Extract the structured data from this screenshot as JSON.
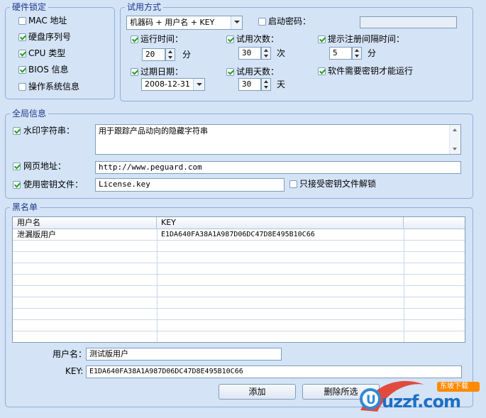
{
  "hardware": {
    "title": "硬件锁定",
    "items": [
      {
        "label": "MAC 地址",
        "checked": false
      },
      {
        "label": "硬盘序列号",
        "checked": true
      },
      {
        "label": "CPU 类型",
        "checked": true
      },
      {
        "label": "BIOS 信息",
        "checked": true
      },
      {
        "label": "操作系统信息",
        "checked": false
      }
    ]
  },
  "trial": {
    "title": "试用方式",
    "mode_select": "机器码 + 用户名 + KEY",
    "startup_password_label": "启动密码：",
    "startup_password_value": "",
    "run_time_label": "运行时间：",
    "run_time_value": "20",
    "run_time_unit": "分",
    "trial_count_label": "试用次数：",
    "trial_count_value": "30",
    "trial_count_unit": "次",
    "reg_interval_label": "提示注册间隔时间：",
    "reg_interval_value": "5",
    "reg_interval_unit": "分",
    "expiry_label": "过期日期：",
    "expiry_value": "2008-12-31",
    "trial_days_label": "试用天数：",
    "trial_days_value": "30",
    "trial_days_unit": "天",
    "need_key_label": "软件需要密钥才能运行"
  },
  "global": {
    "title": "全局信息",
    "watermark_label": "水印字符串：",
    "watermark_value": "用于跟踪产品动向的隐藏字符串",
    "url_label": "网页地址：",
    "url_value": "http://www.peguard.com",
    "keyfile_label": "使用密钥文件：",
    "keyfile_value": "License.key",
    "keyfile_only_label": "只接受密钥文件解锁"
  },
  "blacklist": {
    "title": "黑名单",
    "columns": [
      "用户名",
      "KEY"
    ],
    "rows": [
      {
        "user": "泄漏版用户",
        "key": "E1DA640FA38A1A987D06DC47D8E495B10C66"
      }
    ],
    "username_label": "用户名：",
    "username_value": "测试版用户",
    "key_label": "KEY:",
    "key_value": "E1DA640FA38A1A987D06DC47D8E495B10C66",
    "add_button": "添加",
    "delete_button": "删除所选"
  },
  "watermark_logo": {
    "text": "uzzf.com",
    "badge": "东坡下载"
  },
  "colors": {
    "background": "#d4e3f6",
    "group_border": "#8fb0d9",
    "title_text": "#1d3a8a",
    "check_mark": "#21a121"
  }
}
